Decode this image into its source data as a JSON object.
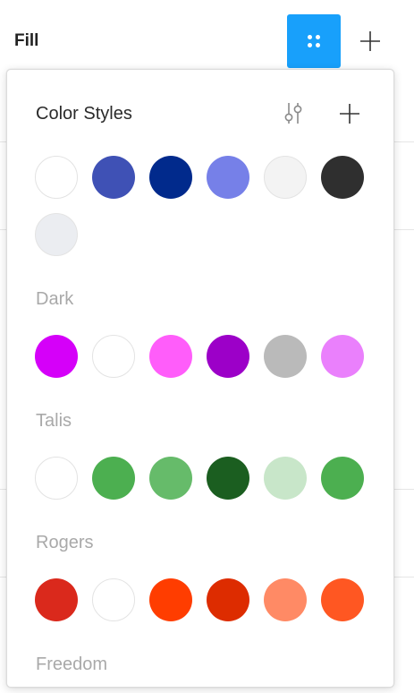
{
  "fill": {
    "title": "Fill",
    "styles_button_icon": "style-grid-icon",
    "add_button_icon": "plus-icon"
  },
  "color_styles": {
    "title": "Color Styles",
    "adjust_icon": "sliders-icon",
    "add_icon": "plus-icon",
    "ungrouped": [
      {
        "color": "#ffffff"
      },
      {
        "color": "#3f51b5"
      },
      {
        "color": "#012a8c"
      },
      {
        "color": "#7680e8"
      },
      {
        "color": "#f3f3f3"
      },
      {
        "color": "#2f2f2f"
      },
      {
        "color": "#ebedf1"
      }
    ],
    "groups": [
      {
        "label": "Dark",
        "swatches": [
          {
            "color": "#d500f9"
          },
          {
            "color": "#ffffff"
          },
          {
            "color": "#ff5dfa"
          },
          {
            "color": "#9c00c8"
          },
          {
            "color": "#bababa"
          },
          {
            "color": "#ea80fc"
          }
        ]
      },
      {
        "label": "Talis",
        "swatches": [
          {
            "color": "#ffffff"
          },
          {
            "color": "#4caf50"
          },
          {
            "color": "#66bb6a"
          },
          {
            "color": "#1b5e20"
          },
          {
            "color": "#c8e6c9"
          },
          {
            "color": "#4caf50"
          }
        ]
      },
      {
        "label": "Rogers",
        "swatches": [
          {
            "color": "#da291c"
          },
          {
            "color": "#ffffff"
          },
          {
            "color": "#ff3d00"
          },
          {
            "color": "#dd2c00"
          },
          {
            "color": "#ff8a65"
          },
          {
            "color": "#ff5722"
          }
        ]
      },
      {
        "label": "Freedom",
        "swatches": []
      }
    ]
  }
}
